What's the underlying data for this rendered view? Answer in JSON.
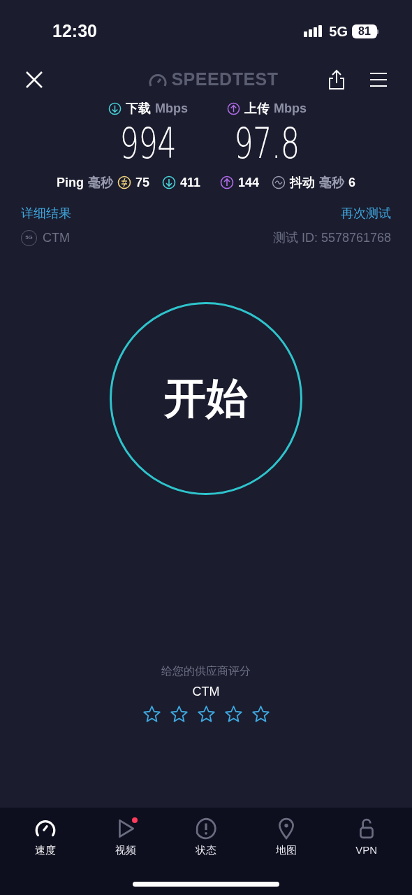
{
  "status_bar": {
    "time": "12:30",
    "network": "5G",
    "battery": "81"
  },
  "header": {
    "brand": "SPEEDTEST"
  },
  "results": [
    {
      "kind": "download",
      "label": "下载",
      "unit": "Mbps",
      "value": "994"
    },
    {
      "kind": "upload",
      "label": "上传",
      "unit": "Mbps",
      "value": "97.8"
    }
  ],
  "latency": {
    "ping_label": "Ping",
    "ping_unit": "毫秒",
    "idle": "75",
    "download": "411",
    "upload": "144",
    "jitter_label": "抖动",
    "jitter_unit": "毫秒",
    "jitter": "6"
  },
  "links": {
    "details": "详细结果",
    "retest": "再次测试"
  },
  "connection": {
    "network_badge": "5G",
    "provider": "CTM",
    "test_id": "测试 ID: 5578761768"
  },
  "start_button": "开始",
  "rating": {
    "prompt": "给您的供应商评分",
    "provider": "CTM",
    "stars": 0
  },
  "nav": [
    {
      "kind": "speed",
      "label": "速度",
      "selected": true,
      "badge": false
    },
    {
      "kind": "video",
      "label": "视频",
      "selected": false,
      "badge": true
    },
    {
      "kind": "status",
      "label": "状态",
      "selected": false,
      "badge": false
    },
    {
      "kind": "map",
      "label": "地图",
      "selected": false,
      "badge": false
    },
    {
      "kind": "vpn",
      "label": "VPN",
      "selected": false,
      "badge": false
    }
  ]
}
